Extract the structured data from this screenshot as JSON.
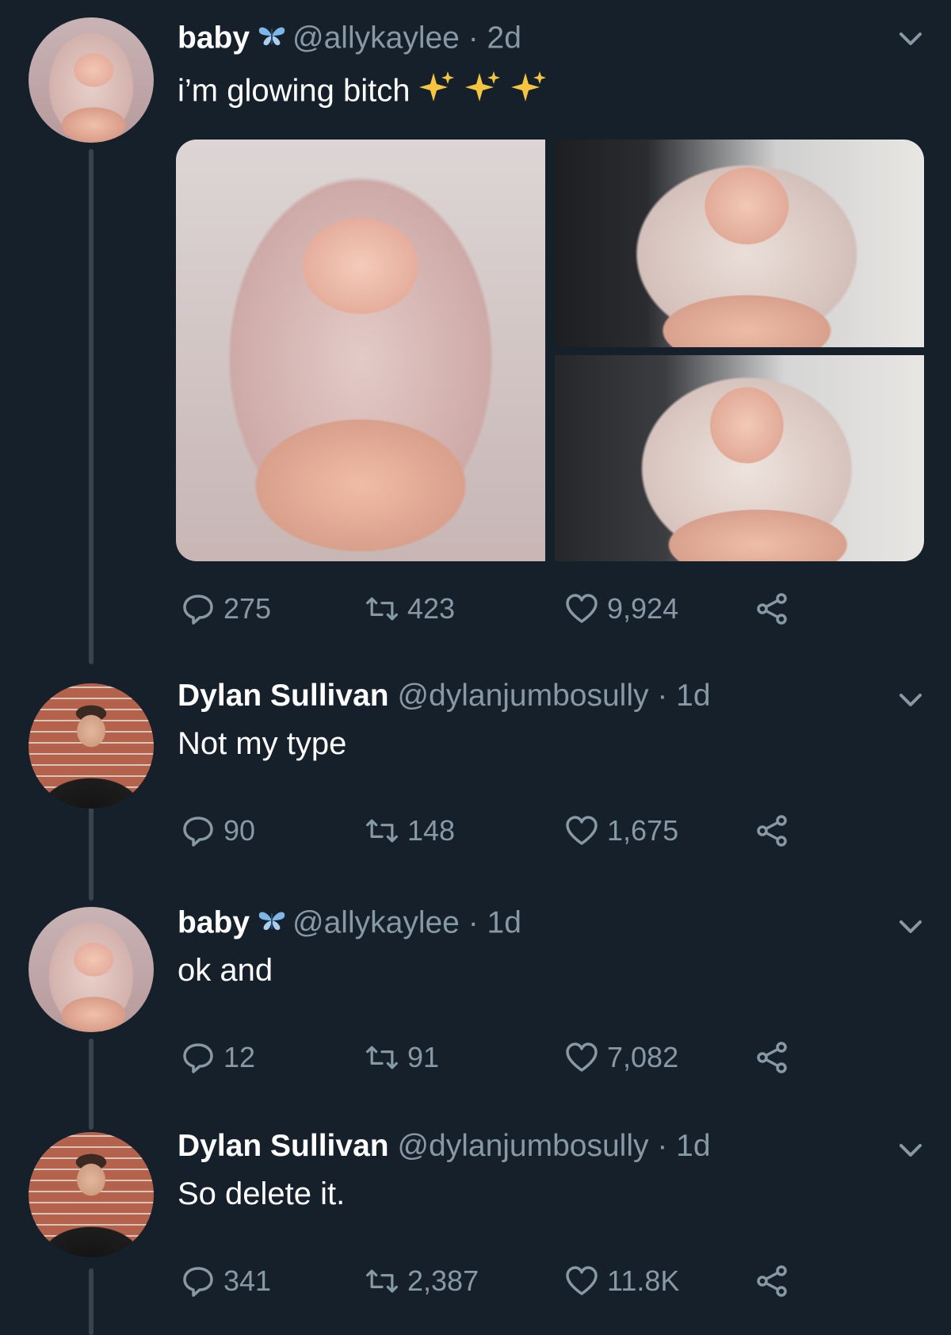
{
  "theme": {
    "background": "#15202b",
    "text": "#ffffff",
    "muted": "#8899a6",
    "thread_line": "#38444d"
  },
  "tweets": [
    {
      "name": "baby",
      "handle": "@allykaylee · 2d",
      "text": "i’m glowing bitch",
      "has_butterfly": true,
      "has_sparkles": true,
      "media_count": 3,
      "replies": "275",
      "retweets": "423",
      "likes": "9,924"
    },
    {
      "name": "Dylan Sullivan",
      "handle": "@dylanjumbosully · 1d",
      "text": "Not my type",
      "replies": "90",
      "retweets": "148",
      "likes": "1,675"
    },
    {
      "name": "baby",
      "handle": "@allykaylee · 1d",
      "text": "ok and",
      "has_butterfly": true,
      "replies": "12",
      "retweets": "91",
      "likes": "7,082"
    },
    {
      "name": "Dylan Sullivan",
      "handle": "@dylanjumbosully · 1d",
      "text": "So delete it.",
      "replies": "341",
      "retweets": "2,387",
      "likes": "11.8K"
    }
  ],
  "icons": [
    "chevron-down-icon",
    "butterfly-icon",
    "sparkles-icon",
    "reply-icon",
    "retweet-icon",
    "like-icon",
    "share-icon"
  ]
}
